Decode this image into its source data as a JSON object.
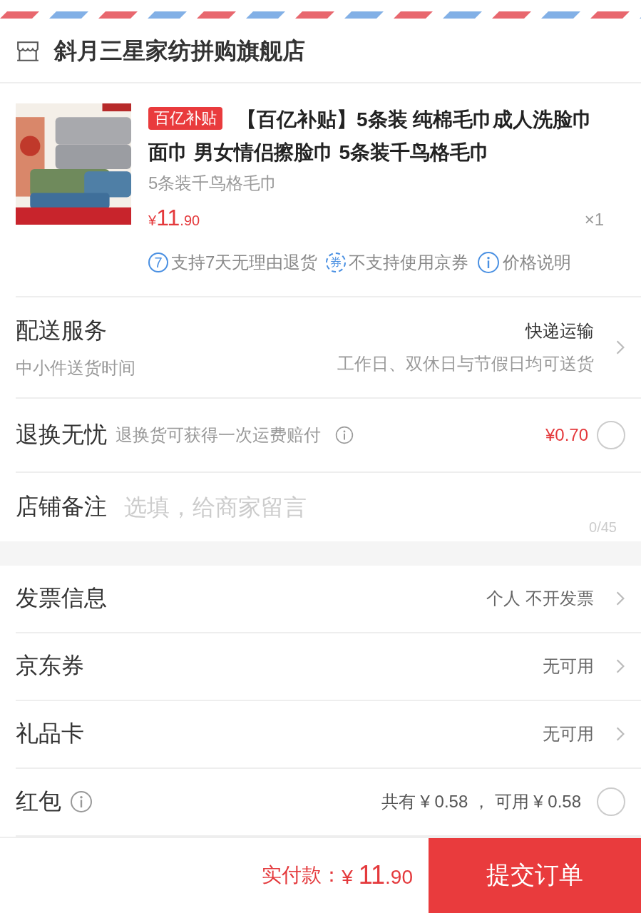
{
  "store": {
    "name": "斜月三星家纺拼购旗舰店"
  },
  "product": {
    "badge": "百亿补贴",
    "title": "【百亿补贴】5条装 纯棉毛巾成人洗脸巾面巾 男女情侣擦脸巾 5条装千鸟格毛巾",
    "spec": "5条装千鸟格毛巾",
    "price": {
      "currency": "¥",
      "integer": "11",
      "decimal": ".90"
    },
    "quantity": "×1",
    "services": [
      {
        "kind": "number",
        "icon": "7",
        "text": "支持7天无理由退货"
      },
      {
        "kind": "struck",
        "icon": "券",
        "text": "不支持使用京券"
      },
      {
        "kind": "info",
        "text": "价格说明"
      }
    ]
  },
  "order_rows": [
    {
      "kind": "delivery",
      "title": "配送服务",
      "subtitle": "中小件送货时间",
      "value": "快递运输",
      "note": "工作日、双休日与节假日均可送货"
    },
    {
      "kind": "insurance",
      "title": "退换无忧",
      "desc": "退换货可获得一次运费赔付",
      "price": "¥0.70",
      "checked": false
    },
    {
      "kind": "remark",
      "title": "店铺备注",
      "placeholder": "选填，给商家留言",
      "counter": "0/45"
    }
  ],
  "payment_rows": [
    {
      "kind": "link",
      "title": "发票信息",
      "value": "个人 不开发票"
    },
    {
      "kind": "link",
      "title": "京东券",
      "value": "无可用"
    },
    {
      "kind": "link",
      "title": "礼品卡",
      "value": "无可用"
    },
    {
      "kind": "radio",
      "title": "红包",
      "info": true,
      "value": "共有 ¥ 0.58 ， 可用 ¥ 0.58",
      "checked": false
    }
  ],
  "footer": {
    "label": "实付款：",
    "currency": "¥",
    "integer": "11",
    "decimal": ".90",
    "button": "提交订单"
  }
}
